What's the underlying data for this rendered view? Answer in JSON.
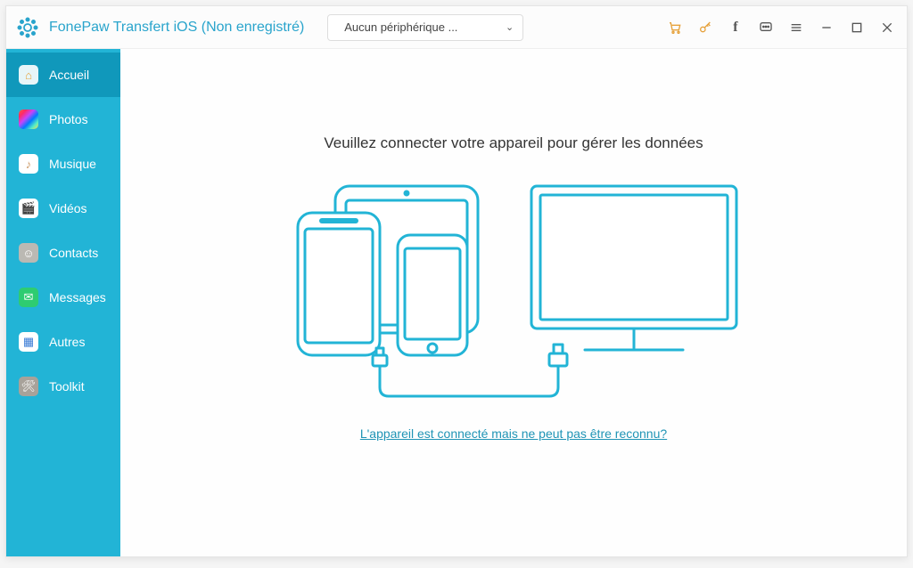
{
  "app": {
    "title": "FonePaw Transfert iOS (Non enregistré)"
  },
  "device_dropdown": {
    "label": "Aucun périphérique ..."
  },
  "titlebar_icons": {
    "cart": "cart-icon",
    "key": "key-icon",
    "facebook": "facebook-icon",
    "feedback": "feedback-icon",
    "menu": "menu-icon",
    "minimize": "minimize-icon",
    "maximize": "maximize-icon",
    "close": "close-icon"
  },
  "sidebar": {
    "items": [
      {
        "label": "Accueil",
        "icon": "home-icon",
        "active": true
      },
      {
        "label": "Photos",
        "icon": "photos-icon",
        "active": false
      },
      {
        "label": "Musique",
        "icon": "music-icon",
        "active": false
      },
      {
        "label": "Vidéos",
        "icon": "videos-icon",
        "active": false
      },
      {
        "label": "Contacts",
        "icon": "contacts-icon",
        "active": false
      },
      {
        "label": "Messages",
        "icon": "messages-icon",
        "active": false
      },
      {
        "label": "Autres",
        "icon": "autres-icon",
        "active": false
      },
      {
        "label": "Toolkit",
        "icon": "toolkit-icon",
        "active": false
      }
    ]
  },
  "main": {
    "connect_prompt": "Veuillez connecter votre appareil pour gérer les données",
    "help_link": "L'appareil est connecté mais ne peut pas être reconnu?"
  },
  "colors": {
    "brand": "#29a4cc",
    "sidebar": "#22b4d6",
    "accent": "#e6a13a"
  }
}
